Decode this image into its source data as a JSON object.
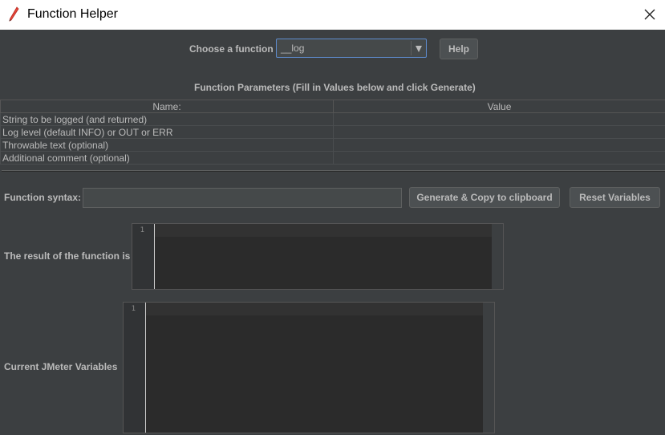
{
  "window": {
    "title": "Function Helper",
    "icon": "feather-pen-icon",
    "close_icon": "close-icon"
  },
  "chooser": {
    "label": "Choose a function",
    "selected": "__log",
    "help_label": "Help"
  },
  "params": {
    "title": "Function Parameters (Fill in Values below and click Generate)",
    "columns": [
      "Name:",
      "Value"
    ],
    "rows": [
      {
        "name": "String to be logged (and returned)",
        "value": ""
      },
      {
        "name": "Log level (default INFO) or OUT or ERR",
        "value": ""
      },
      {
        "name": "Throwable text (optional)",
        "value": ""
      },
      {
        "name": "Additional comment (optional)",
        "value": ""
      }
    ]
  },
  "syntax": {
    "label": "Function syntax:",
    "value": "",
    "generate_label": "Generate & Copy to clipboard",
    "reset_label": "Reset Variables"
  },
  "result": {
    "label": "The result of the function is",
    "line_number": "1"
  },
  "variables": {
    "label": "Current JMeter Variables",
    "line_number": "1"
  },
  "colors": {
    "background": "#3c3f41",
    "editor_background": "#2b2b2b",
    "focus_border": "#5e8bcc",
    "text": "#bbbbbb"
  }
}
